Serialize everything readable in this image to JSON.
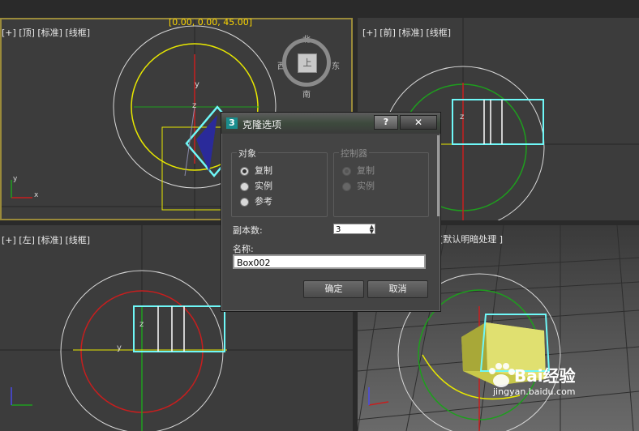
{
  "viewports": {
    "top": {
      "label": "[+] [顶] [标准] [线框]",
      "coord": "[0.00, 0.00, 45.00]"
    },
    "front": {
      "label": "[+] [前] [标准] [线框]"
    },
    "left": {
      "label": "[+] [左] [标准] [线框]"
    },
    "perspective": {
      "label": "[默认明暗处理 ]"
    }
  },
  "viewcube": {
    "north": "北",
    "south": "南",
    "east": "东",
    "west": "西",
    "face": "上"
  },
  "axis_labels": {
    "x": "x",
    "y": "y",
    "z": "z"
  },
  "dialog": {
    "icon": "3",
    "title": "克隆选项",
    "help": "?",
    "close": "✕",
    "object_group": {
      "title": "对象",
      "options": [
        {
          "label": "复制",
          "selected": true
        },
        {
          "label": "实例",
          "selected": false
        },
        {
          "label": "参考",
          "selected": false
        }
      ]
    },
    "controller_group": {
      "title": "控制器",
      "options": [
        {
          "label": "复制",
          "selected": true
        },
        {
          "label": "实例",
          "selected": false
        }
      ]
    },
    "copies_label": "副本数:",
    "copies_value": "3",
    "name_label": "名称:",
    "name_value": "Box002",
    "ok": "确定",
    "cancel": "取消"
  },
  "watermark": {
    "text": "Bai经验",
    "url": "jingyan.baidu.com"
  },
  "colors": {
    "selection": "#6ff8f8",
    "axis_yellow": "#e8e800",
    "gizmo_red": "#c81e1e",
    "gizmo_green": "#1e9e1e"
  }
}
